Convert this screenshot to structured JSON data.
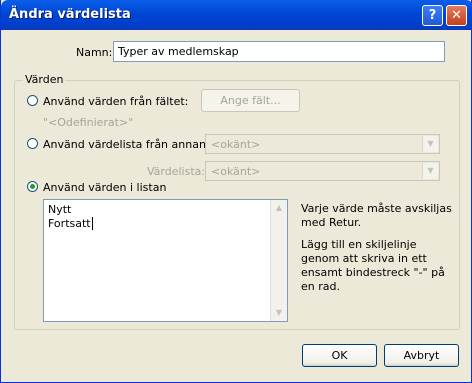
{
  "window": {
    "title": "Ändra värdelista",
    "help_glyph": "?",
    "close_glyph": "✕"
  },
  "name_field": {
    "label": "Namn:",
    "value": "Typer av medlemskap"
  },
  "values_group": {
    "label": "Värden",
    "option_field": {
      "label": "Använd värden från fältet:",
      "button": "Ange fält...",
      "undefined_text": "\"<Odefinierat>\""
    },
    "option_file": {
      "label": "Använd värdelista från annan fil:",
      "file_value": "<okänt>",
      "list_label": "Värdelista:",
      "list_value": "<okänt>"
    },
    "option_list": {
      "label": "Använd värden i listan",
      "selected": true
    },
    "list_lines": [
      "Nytt",
      "Fortsatt"
    ],
    "note_1": "Varje värde måste avskiljas med Retur.",
    "note_2": "Lägg till en skiljelinje genom att skriva in ett ensamt bindestreck \"-\" på en rad."
  },
  "buttons": {
    "ok": "OK",
    "cancel": "Avbryt"
  }
}
